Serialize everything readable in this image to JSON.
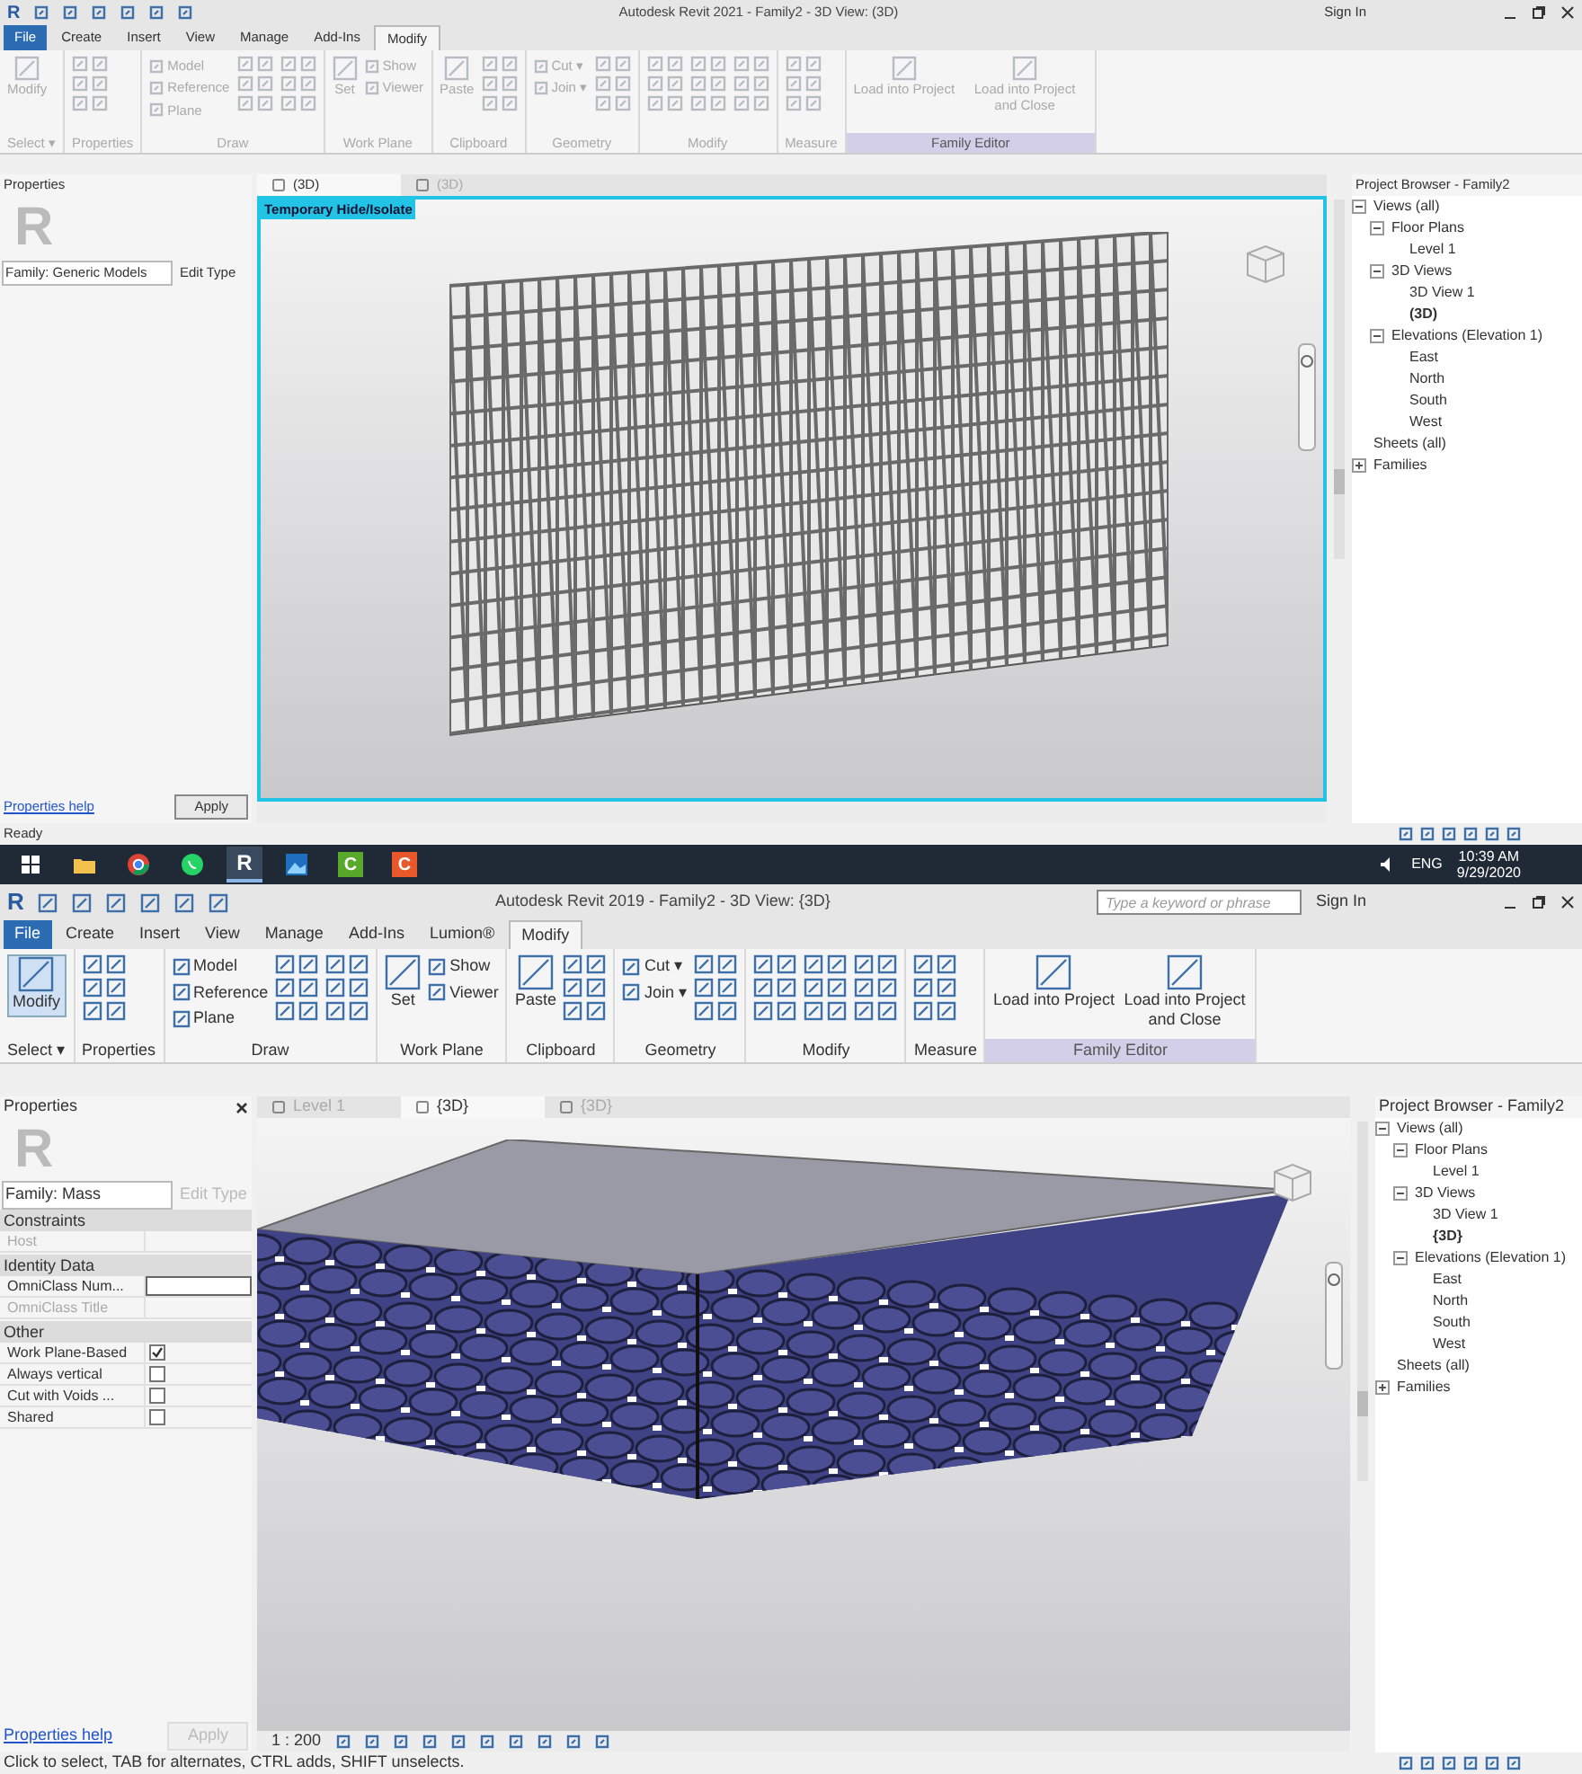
{
  "windows": [
    {
      "logo": "R",
      "title": "Autodesk Revit 2021 - Family2 - 3D View: (3D)",
      "sign_in": "Sign In",
      "ribbon_disabled": true,
      "tabs": [
        {
          "label": "File",
          "selected": false
        },
        {
          "label": "Create",
          "selected": false
        },
        {
          "label": "Insert",
          "selected": false
        },
        {
          "label": "View",
          "selected": false
        },
        {
          "label": "Manage",
          "selected": false
        },
        {
          "label": "Add-Ins",
          "selected": false
        },
        {
          "label": "Modify",
          "selected": true
        }
      ],
      "panels": [
        {
          "label": "Select ▾",
          "contextual": false,
          "items": [
            {
              "kind": "large",
              "label": "Modify"
            }
          ]
        },
        {
          "label": "Properties",
          "contextual": false,
          "items": [
            {
              "kind": "icons"
            }
          ]
        },
        {
          "label": "Draw",
          "contextual": false,
          "items": [
            {
              "kind": "small",
              "labels": [
                "Model",
                "Reference",
                "Plane"
              ]
            },
            {
              "kind": "icons"
            },
            {
              "kind": "icons"
            }
          ]
        },
        {
          "label": "Work Plane",
          "contextual": false,
          "items": [
            {
              "kind": "large",
              "label": "Set"
            },
            {
              "kind": "small",
              "labels": [
                "Show",
                "Viewer"
              ]
            }
          ]
        },
        {
          "label": "Clipboard",
          "contextual": false,
          "items": [
            {
              "kind": "large",
              "label": "Paste"
            },
            {
              "kind": "icons"
            }
          ]
        },
        {
          "label": "Geometry",
          "contextual": false,
          "items": [
            {
              "kind": "small",
              "labels": [
                "Cut ▾",
                "Join ▾"
              ]
            },
            {
              "kind": "icons"
            }
          ]
        },
        {
          "label": "Modify",
          "contextual": false,
          "items": [
            {
              "kind": "icons"
            },
            {
              "kind": "icons"
            },
            {
              "kind": "icons"
            }
          ]
        },
        {
          "label": "Measure",
          "contextual": false,
          "items": [
            {
              "kind": "icons"
            }
          ]
        },
        {
          "label": "Family Editor",
          "contextual": true,
          "items": [
            {
              "kind": "large",
              "label": "Load into Project"
            },
            {
              "kind": "large",
              "label": "Load into Project and Close"
            }
          ]
        }
      ],
      "properties": {
        "title": "Properties",
        "logo": "R",
        "family": "Family: Generic Models",
        "edit_type": "Edit Type",
        "edit_disabled": false,
        "help": "Properties help",
        "apply": "Apply",
        "apply_disabled": false
      },
      "view_tabs": [
        {
          "label": "(3D)",
          "selected": true
        },
        {
          "label": "(3D)",
          "selected": false
        }
      ],
      "banner": "Temporary Hide/Isolate",
      "viewport": {
        "kind": "lattice"
      },
      "browser": {
        "title": "Project Browser - Family2",
        "tree": [
          {
            "label": "Views (all)",
            "expanded": true,
            "children": [
              {
                "label": "Floor Plans",
                "expanded": true,
                "children": [
                  {
                    "label": "Level 1"
                  }
                ]
              },
              {
                "label": "3D Views",
                "expanded": true,
                "children": [
                  {
                    "label": "3D View 1",
                    "current": false
                  },
                  {
                    "label": "(3D)",
                    "current": true
                  }
                ]
              },
              {
                "label": "Elevations (Elevation 1)",
                "expanded": true,
                "children": [
                  {
                    "label": "East"
                  },
                  {
                    "label": "North"
                  },
                  {
                    "label": "South"
                  },
                  {
                    "label": "West"
                  }
                ]
              }
            ]
          },
          {
            "label": "Sheets (all)"
          },
          {
            "label": "Families",
            "expanded": false
          }
        ]
      },
      "status": "Ready"
    },
    {
      "logo": "R",
      "title": "Autodesk Revit 2019 - Family2 - 3D View: {3D}",
      "search": {
        "placeholder": "Type a keyword or phrase"
      },
      "sign_in": "Sign In",
      "ribbon_disabled": false,
      "tabs": [
        {
          "label": "File",
          "selected": false
        },
        {
          "label": "Create",
          "selected": false
        },
        {
          "label": "Insert",
          "selected": false
        },
        {
          "label": "View",
          "selected": false
        },
        {
          "label": "Manage",
          "selected": false
        },
        {
          "label": "Add-Ins",
          "selected": false
        },
        {
          "label": "Lumion®",
          "selected": false
        },
        {
          "label": "Modify",
          "selected": true
        }
      ],
      "panels": [
        {
          "label": "Select ▾",
          "contextual": false,
          "items": [
            {
              "kind": "large",
              "label": "Modify"
            }
          ]
        },
        {
          "label": "Properties",
          "contextual": false,
          "items": [
            {
              "kind": "icons"
            }
          ]
        },
        {
          "label": "Draw",
          "contextual": false,
          "items": [
            {
              "kind": "small",
              "labels": [
                "Model",
                "Reference",
                "Plane"
              ]
            },
            {
              "kind": "icons"
            },
            {
              "kind": "icons"
            }
          ]
        },
        {
          "label": "Work Plane",
          "contextual": false,
          "items": [
            {
              "kind": "large",
              "label": "Set"
            },
            {
              "kind": "small",
              "labels": [
                "Show",
                "Viewer"
              ]
            }
          ]
        },
        {
          "label": "Clipboard",
          "contextual": false,
          "items": [
            {
              "kind": "large",
              "label": "Paste"
            },
            {
              "kind": "icons"
            }
          ]
        },
        {
          "label": "Geometry",
          "contextual": false,
          "items": [
            {
              "kind": "small",
              "labels": [
                "Cut ▾",
                "Join ▾"
              ]
            },
            {
              "kind": "icons"
            }
          ]
        },
        {
          "label": "Modify",
          "contextual": false,
          "items": [
            {
              "kind": "icons"
            },
            {
              "kind": "icons"
            },
            {
              "kind": "icons"
            }
          ]
        },
        {
          "label": "Measure",
          "contextual": false,
          "items": [
            {
              "kind": "icons"
            }
          ]
        },
        {
          "label": "Family Editor",
          "contextual": true,
          "items": [
            {
              "kind": "large",
              "label": "Load into Project"
            },
            {
              "kind": "large",
              "label": "Load into Project and Close"
            }
          ]
        }
      ],
      "properties": {
        "title": "Properties",
        "logo": "R",
        "family": "Family: Mass",
        "edit_type": "Edit Type",
        "edit_disabled": true,
        "sections": [
          {
            "label": "Constraints",
            "rows": [
              {
                "kind": "text",
                "label": "Host",
                "disabled": true
              }
            ]
          },
          {
            "label": "Identity Data",
            "rows": [
              {
                "kind": "field",
                "label": "OmniClass Num...",
                "disabled": false
              },
              {
                "kind": "text",
                "label": "OmniClass Title",
                "disabled": true
              }
            ]
          },
          {
            "label": "Other",
            "rows": [
              {
                "kind": "checkbox",
                "label": "Work Plane-Based",
                "checked": true
              },
              {
                "kind": "checkbox",
                "label": "Always vertical",
                "checked": false
              },
              {
                "kind": "checkbox",
                "label": "Cut with Voids ...",
                "checked": false
              },
              {
                "kind": "checkbox",
                "label": "Shared",
                "checked": false
              }
            ]
          }
        ],
        "help": "Properties help",
        "apply": "Apply",
        "apply_disabled": true
      },
      "view_tabs": [
        {
          "label": "Level 1",
          "selected": false
        },
        {
          "label": "{3D}",
          "selected": true
        },
        {
          "label": "{3D}",
          "selected": false
        }
      ],
      "scale": "1 : 200",
      "viewport": {
        "kind": "mass"
      },
      "browser": {
        "title": "Project Browser - Family2",
        "tree": [
          {
            "label": "Views (all)",
            "expanded": true,
            "children": [
              {
                "label": "Floor Plans",
                "expanded": true,
                "children": [
                  {
                    "label": "Level 1"
                  }
                ]
              },
              {
                "label": "3D Views",
                "expanded": true,
                "children": [
                  {
                    "label": "3D View 1",
                    "current": false
                  },
                  {
                    "label": "{3D}",
                    "current": true
                  }
                ]
              },
              {
                "label": "Elevations (Elevation 1)",
                "expanded": true,
                "children": [
                  {
                    "label": "East"
                  },
                  {
                    "label": "North"
                  },
                  {
                    "label": "South"
                  },
                  {
                    "label": "West"
                  }
                ]
              }
            ]
          },
          {
            "label": "Sheets (all)"
          },
          {
            "label": "Families",
            "expanded": false
          }
        ]
      },
      "status": "Click to select, TAB for alternates, CTRL adds, SHIFT unselects."
    }
  ],
  "taskbar": {
    "apps": [
      {
        "kind": "start"
      },
      {
        "kind": "folder"
      },
      {
        "kind": "browser"
      },
      {
        "kind": "chat"
      },
      {
        "kind": "letter",
        "label": "R"
      },
      {
        "kind": "picture"
      },
      {
        "kind": "green",
        "label": "C"
      },
      {
        "kind": "orange",
        "label": "C"
      }
    ],
    "language": "ENG",
    "time": "10:39 AM",
    "date": "9/29/2020"
  }
}
